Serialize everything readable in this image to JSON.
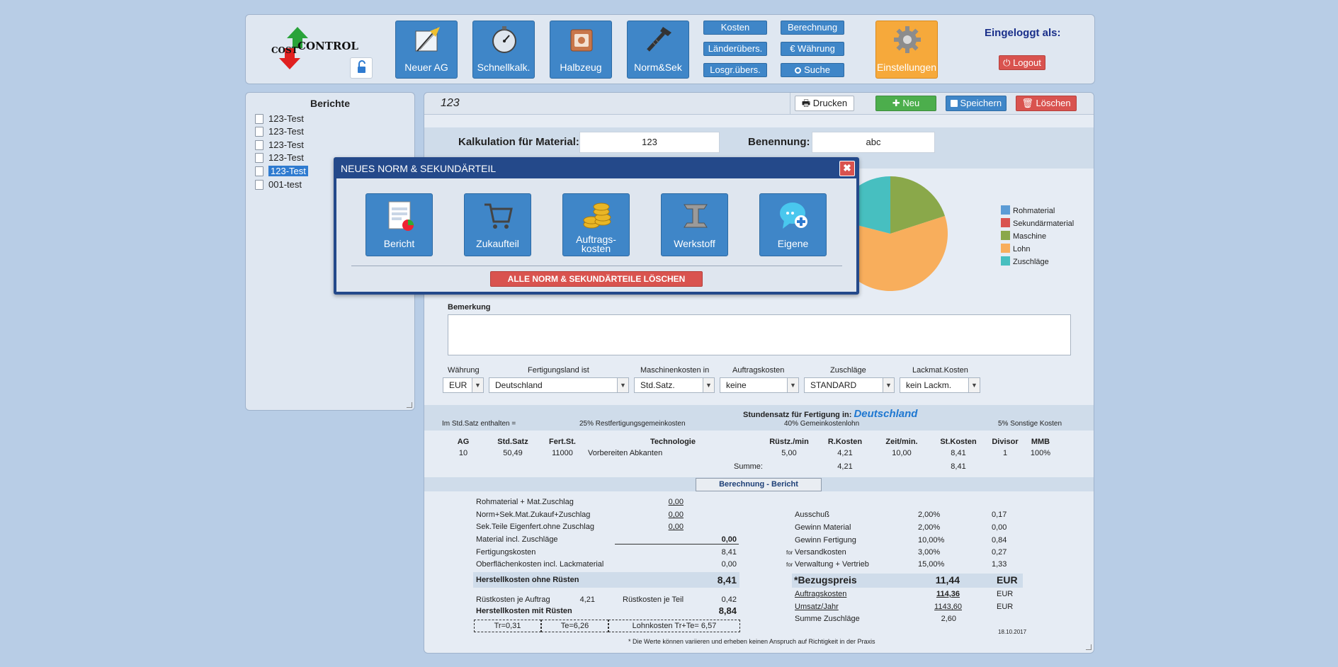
{
  "header": {
    "logo_text_cost": "COST",
    "logo_text_control": "CONTROL",
    "big_buttons": [
      {
        "label": "Neuer AG",
        "icon": "drafting-tools-icon"
      },
      {
        "label": "Schnellkalk.",
        "icon": "stopwatch-icon"
      },
      {
        "label": "Halbzeug",
        "icon": "material-block-icon"
      },
      {
        "label": "Norm&Sek",
        "icon": "screw-icon"
      }
    ],
    "small_buttons_left": [
      "Kosten",
      "Länderübers.",
      "Losgr.übers."
    ],
    "small_buttons_right": [
      "Berechnung",
      "€ Währung",
      "Suche"
    ],
    "settings_label": "Einstellungen",
    "logged_in_label": "Eingeloggt als:",
    "logout_label": "Logout"
  },
  "sidebar": {
    "title": "Berichte",
    "items": [
      "123-Test",
      "123-Test",
      "123-Test",
      "123-Test",
      "123-Test",
      "001-test"
    ],
    "selected_index": 4
  },
  "toolbar": {
    "doc_name": "123",
    "print_label": "Drucken",
    "new_label": "Neu",
    "save_label": "Speichern",
    "delete_label": "Löschen"
  },
  "form": {
    "material_label": "Kalkulation für Material:",
    "material_value": "123",
    "name_label": "Benennung:",
    "name_value": "abc",
    "remark_label": "Bemerkung",
    "remark_value": ""
  },
  "selects": [
    {
      "label": "Währung",
      "value": "EUR"
    },
    {
      "label": "Fertigungsland ist",
      "value": "Deutschland"
    },
    {
      "label": "Maschinenkosten in",
      "value": "Std.Satz."
    },
    {
      "label": "Auftragskosten",
      "value": "keine"
    },
    {
      "label": "Zuschläge",
      "value": "STANDARD"
    },
    {
      "label": "Lackmat.Kosten",
      "value": "kein Lackm."
    }
  ],
  "rate": {
    "title": "Stundensatz für Fertigung in:",
    "country": "Deutschland",
    "included_label": "Im Std.Satz enthalten =",
    "items": [
      "25% Restfertigungsgemeinkosten",
      "40% Gemeinkostenlohn",
      "5% Sonstige Kosten"
    ]
  },
  "operations": {
    "headers": [
      "AG",
      "Std.Satz",
      "Fert.St.",
      "Technologie",
      "Rüstz./min",
      "R.Kosten",
      "Zeit/min.",
      "St.Kosten",
      "Divisor",
      "MMB"
    ],
    "rows": [
      [
        "10",
        "50,49",
        "11000",
        "Vorbereiten Abkanten",
        "5,00",
        "4,21",
        "10,00",
        "8,41",
        "1",
        "100%"
      ]
    ],
    "sum_label": "Summe:",
    "sum_rkosten": "4,21",
    "sum_stkosten": "8,41"
  },
  "report": {
    "title": "Berechnung - Bericht",
    "left": [
      {
        "label": "Rohmaterial + Mat.Zuschlag",
        "value": "0,00"
      },
      {
        "label": "Norm+Sek.Mat.Zukauf+Zuschlag",
        "value": "0,00"
      },
      {
        "label": "Sek.Teile Eigenfert.ohne Zuschlag",
        "value": "0,00"
      },
      {
        "label": "Material incl. Zuschläge",
        "value": "0,00"
      },
      {
        "label": "Fertigungskosten",
        "value": "8,41"
      },
      {
        "label": "Oberflächenkosten incl. Lackmaterial",
        "value": "0,00"
      }
    ],
    "hk_label": "Herstellkosten ohne Rüsten",
    "hk_value": "8,41",
    "setup_order_label": "Rüstkosten je Auftrag",
    "setup_order_value": "4,21",
    "setup_part_label": "Rüstkosten je Teil",
    "setup_part_value": "0,42",
    "hk2_label": "Herstellkosten mit Rüsten",
    "hk2_value": "8,84",
    "tr": "Tr=0,31",
    "te": "Te=6,26",
    "lohn": "Lohnkosten Tr+Te= 6,57",
    "right": [
      {
        "prefix": "",
        "label": "Ausschuß",
        "pct": "2,00%",
        "value": "0,17"
      },
      {
        "prefix": "",
        "label": "Gewinn Material",
        "pct": "2,00%",
        "value": "0,00"
      },
      {
        "prefix": "",
        "label": "Gewinn Fertigung",
        "pct": "10,00%",
        "value": "0,84"
      },
      {
        "prefix": "for",
        "label": "Versandkosten",
        "pct": "3,00%",
        "value": "0,27"
      },
      {
        "prefix": "for",
        "label": "Verwaltung + Vertrieb",
        "pct": "15,00%",
        "value": "1,33"
      }
    ],
    "price_label": "*Bezugspreis",
    "price_value": "11,44",
    "price_cur": "EUR",
    "order_cost_label": "Auftragskosten",
    "order_cost_value": "114,36",
    "order_cost_cur": "EUR",
    "revenue_label": "Umsatz/Jahr",
    "revenue_value": "1143,60",
    "revenue_cur": "EUR",
    "sum_surcharge_label": "Summe Zuschläge",
    "sum_surcharge_value": "2,60",
    "date": "18.10.2017",
    "footnote": "* Die Werte können variieren und erheben keinen Anspruch auf Richtigkeit in der Praxis"
  },
  "chart_legend": [
    {
      "label": "Rohmaterial",
      "color": "#5b9bd5"
    },
    {
      "label": "Sekundärmaterial",
      "color": "#d9534f"
    },
    {
      "label": "Maschine",
      "color": "#8aa84a"
    },
    {
      "label": "Lohn",
      "color": "#f8ae5c"
    },
    {
      "label": "Zuschläge",
      "color": "#47bfc0"
    }
  ],
  "chart_data": {
    "type": "pie",
    "categories": [
      "Rohmaterial",
      "Sekundärmaterial",
      "Maschine",
      "Lohn",
      "Zuschläge"
    ],
    "values": [
      0,
      0,
      20,
      59,
      21
    ]
  },
  "modal": {
    "title": "NEUES NORM & SEKUNDÄRTEIL",
    "buttons": [
      {
        "label": "Bericht",
        "icon": "report-icon"
      },
      {
        "label": "Zukaufteil",
        "icon": "cart-icon"
      },
      {
        "label": "Auftrags-\nkosten",
        "icon": "coins-icon"
      },
      {
        "label": "Werkstoff",
        "icon": "steel-beam-icon"
      },
      {
        "label": "Eigene",
        "icon": "chat-plus-icon"
      }
    ],
    "delete_all_label": "ALLE NORM & SEKUNDÄRTEILE LÖSCHEN"
  }
}
